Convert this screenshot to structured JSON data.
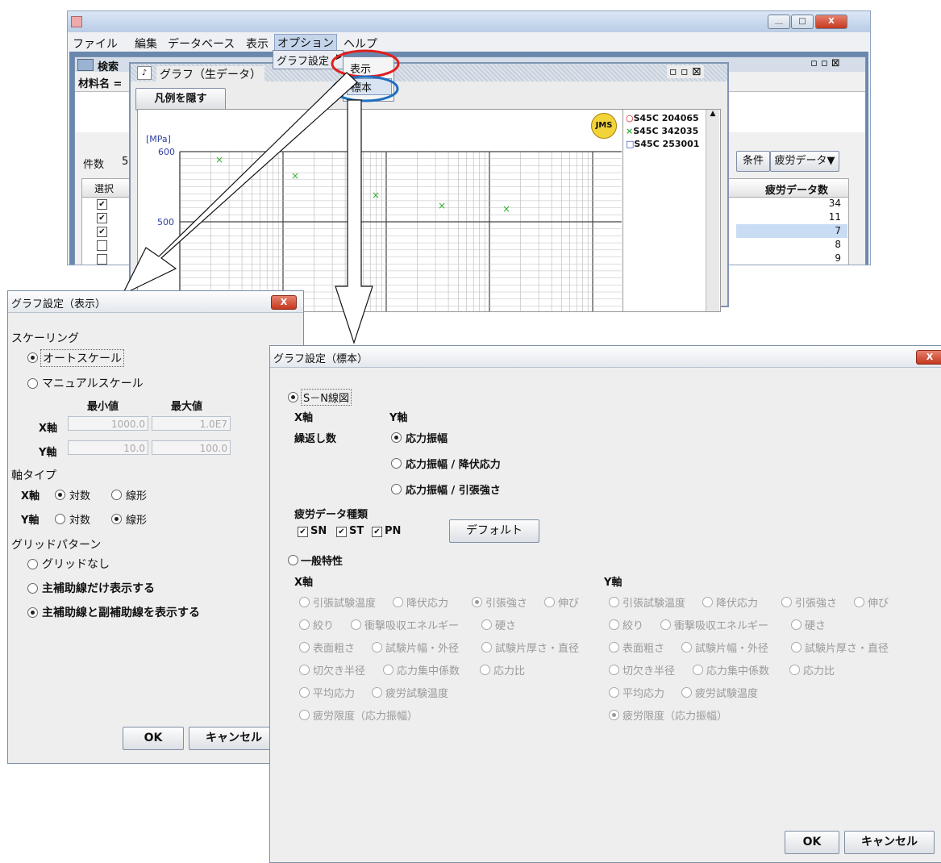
{
  "main": {
    "menus": [
      "ファイル",
      "編集",
      "データベース",
      "表示",
      "オプション",
      "ヘルプ"
    ],
    "dropdown_item": "グラフ設定",
    "submenu": [
      "表示",
      "標本"
    ],
    "search_tab": "検索",
    "material_label": "材料名 =",
    "count_label": "件数",
    "count_value": "5",
    "select_header": "選択",
    "graph_title": "グラフ（生データ）",
    "hide_legend_button": "凡例を隠す",
    "y_unit": "[MPa]",
    "y_ticks": [
      "600",
      "500"
    ],
    "legend": [
      {
        "marker": "○",
        "name": "S45C 204065",
        "color": "#d02020"
      },
      {
        "marker": "×",
        "name": "S45C 342035",
        "color": "#30b030"
      },
      {
        "marker": "□",
        "name": "S45C 253001",
        "color": "#2040c0"
      }
    ],
    "condition_button": "条件",
    "fatigue_data_button": "疲労データ▼",
    "fatigue_count_header": "疲労データ数",
    "fatigue_counts": [
      "34",
      "11",
      "7",
      "8",
      "9"
    ],
    "row_checks": [
      true,
      true,
      true,
      false,
      false
    ],
    "window_buttons": [
      "＿",
      "□",
      "X"
    ],
    "inner_window_buttons": [
      "▫",
      "▫",
      "⊠"
    ]
  },
  "dialog1": {
    "title": "グラフ設定（表示）",
    "close": "X",
    "scaling_label": "スケーリング",
    "auto_scale": "オートスケール",
    "manual_scale": "マニュアルスケール",
    "min_label": "最小値",
    "max_label": "最大値",
    "x_axis": "X軸",
    "y_axis": "Y軸",
    "x_min": "1000.0",
    "x_max": "1.0E7",
    "y_min": "10.0",
    "y_max": "100.0",
    "axis_type_label": "軸タイプ",
    "log": "対数",
    "linear": "線形",
    "grid_pattern_label": "グリッドパターン",
    "grid_none": "グリッドなし",
    "grid_major": "主補助線だけ表示する",
    "grid_both": "主補助線と副補助線を表示する",
    "ok": "OK",
    "cancel": "キャンセル"
  },
  "dialog2": {
    "title": "グラフ設定（標本）",
    "close": "X",
    "sn_diagram": "S－N線図",
    "x_axis": "X軸",
    "y_axis": "Y軸",
    "cycles": "繰返し数",
    "y_opts": [
      "応力振幅",
      "応力振幅 / 降伏応力",
      "応力振幅 / 引張強さ"
    ],
    "fatigue_type_label": "疲労データ種類",
    "checks": [
      "SN",
      "ST",
      "PN"
    ],
    "default_button": "デフォルト",
    "general": "一般特性",
    "rows": [
      [
        "引張試験温度",
        "降伏応力",
        "引張強さ",
        "伸び"
      ],
      [
        "絞り",
        "衝撃吸収エネルギー",
        "硬さ"
      ],
      [
        "表面粗さ",
        "試験片幅・外径",
        "試験片厚さ・直径"
      ],
      [
        "切欠き半径",
        "応力集中係数",
        "応力比"
      ],
      [
        "平均応力",
        "疲労試験温度"
      ],
      [
        "疲労限度（応力振幅）"
      ]
    ],
    "ok": "OK",
    "cancel": "キャンセル"
  }
}
